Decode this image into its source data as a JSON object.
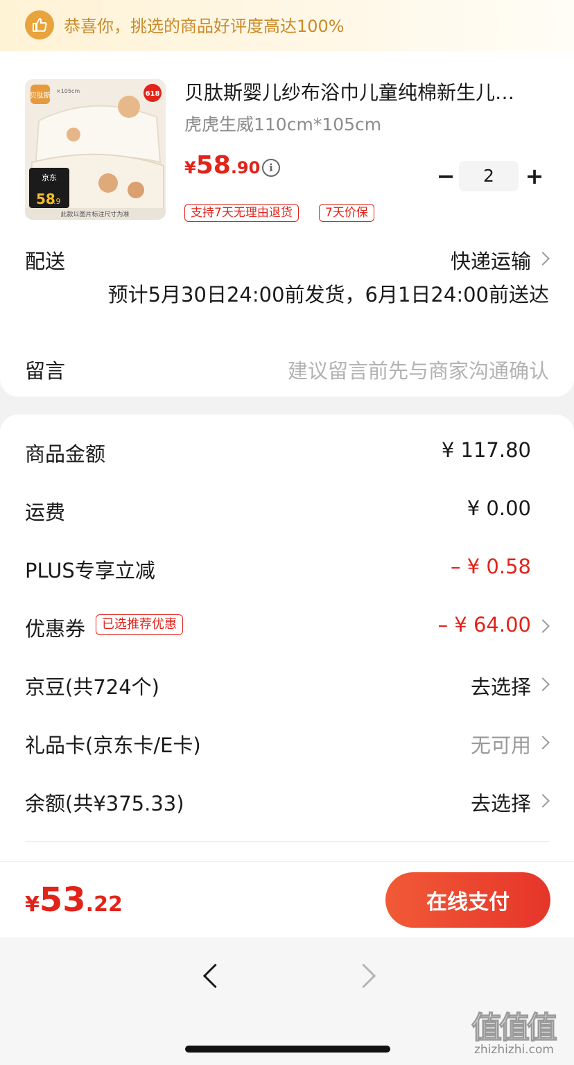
{
  "banner": {
    "text": "恭喜你，挑选的商品好评度高达100%",
    "icon": "thumbs-up-icon"
  },
  "product": {
    "title": "贝肽斯婴儿纱布浴巾儿童纯棉新生儿…",
    "spec": "虎虎生威110cm*105cm",
    "price_currency": "¥",
    "price_int": "58",
    "price_dec": ".90",
    "info_glyph": "i",
    "quantity": "2",
    "minus_glyph": "−",
    "plus_glyph": "+",
    "tags": [
      "支持7天无理由退货",
      "7天价保"
    ],
    "image": {
      "brand": "贝肽斯",
      "badge": "618",
      "sale_label": "京东",
      "price_big": "58",
      "price_small": ".9",
      "caption": "此款以图片标注尺寸为准",
      "size_note": "×105cm"
    }
  },
  "delivery": {
    "label": "配送",
    "method": "快递运输",
    "estimate": "预计5月30日24:00前发货，6月1日24:00前送达"
  },
  "message": {
    "label": "留言",
    "placeholder": "建议留言前先与商家沟通确认"
  },
  "summary": {
    "goods_amount": {
      "label": "商品金额",
      "value": "¥ 117.80"
    },
    "shipping": {
      "label": "运费",
      "value": "¥ 0.00"
    },
    "plus_discount": {
      "label": "PLUS专享立减",
      "value": "– ¥ 0.58"
    },
    "coupon": {
      "label": "优惠券",
      "badge": "已选推荐优惠",
      "value": "– ¥ 64.00"
    },
    "jingdou": {
      "label": "京豆(共724个)",
      "value": "去选择"
    },
    "gift_card": {
      "label": "礼品卡(京东卡/E卡)",
      "value": "无可用"
    },
    "balance": {
      "label": "余额(共¥375.33)",
      "value": "去选择"
    }
  },
  "pay": {
    "total_currency": "¥",
    "total_int": "53",
    "total_dec": ".22",
    "button": "在线支付"
  },
  "watermark": {
    "logo": "值值值",
    "domain": "zhizhizhi.com"
  },
  "colors": {
    "accent_red": "#e2231a",
    "banner_text": "#c98a2a",
    "pay_button": "#e6352a"
  }
}
